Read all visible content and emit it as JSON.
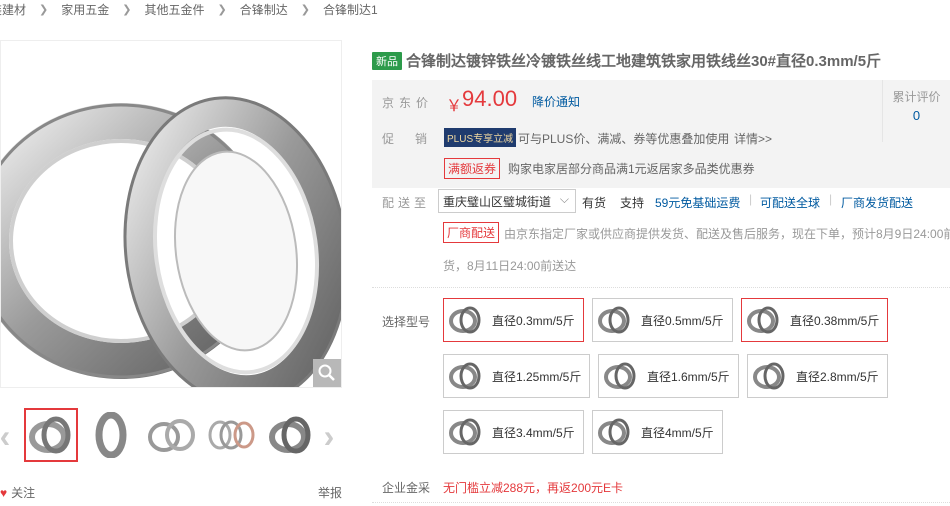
{
  "breadcrumb": [
    "家装建材",
    "家用五金",
    "其他五金件",
    "合锋制达",
    "合锋制达1"
  ],
  "colors": {
    "price_red": "#e4393c",
    "link_blue": "#005aa0",
    "new_green": "#2d9b4b"
  },
  "gallery": {
    "main_alt": "合锋制达镀锌铁丝",
    "zoom_icon": "search-icon",
    "thumbs": [
      {
        "name": "thumb-1"
      },
      {
        "name": "thumb-2"
      },
      {
        "name": "thumb-3"
      },
      {
        "name": "thumb-4"
      },
      {
        "name": "thumb-5"
      }
    ],
    "follow_label": "关注",
    "report_label": "举报"
  },
  "product": {
    "badge": "新品",
    "title": "合锋制达镀锌铁丝冷镀铁丝线工地建筑铁家用铁线丝30#直径0.3mm/5斤"
  },
  "price": {
    "label": "京东价",
    "currency": "￥",
    "value": "94.00",
    "notify": "降价通知"
  },
  "review": {
    "label": "累计评价",
    "count": "0"
  },
  "promo": {
    "label": "促销",
    "plus_badge": "PLUS专享立减",
    "plus_desc": "可与PLUS价、满减、券等优惠叠加使用",
    "detail": "详情>>",
    "coupon_tag": "满额返券",
    "coupon_desc": "购家电家居部分商品满1元返居家多品类优惠券"
  },
  "delivery": {
    "label": "配送至",
    "address": "重庆璧山区璧城街道",
    "stock": "有货",
    "support": "支持",
    "services": [
      "59元免基础运费",
      "可配送全球",
      "厂商发货配送"
    ],
    "factory_tag": "厂商配送",
    "factory_desc": "由京东指定厂家或供应商提供发货、配送及售后服务，现在下单，预计8月9日24:00前",
    "factory_desc2": "货，8月11日24:00前送达"
  },
  "variants": {
    "label": "选择型号",
    "items": [
      {
        "label": "直径0.3mm/5斤",
        "selected": true
      },
      {
        "label": "直径0.5mm/5斤",
        "selected": false
      },
      {
        "label": "直径0.38mm/5斤",
        "selected": true
      },
      {
        "label": "直径1.25mm/5斤",
        "selected": false
      },
      {
        "label": "直径1.6mm/5斤",
        "selected": false
      },
      {
        "label": "直径2.8mm/5斤",
        "selected": false
      },
      {
        "label": "直径3.4mm/5斤",
        "selected": false
      },
      {
        "label": "直径4mm/5斤",
        "selected": false
      }
    ]
  },
  "corporate": {
    "label": "企业金采",
    "desc": "无门槛立减288元，再返200元E卡"
  }
}
